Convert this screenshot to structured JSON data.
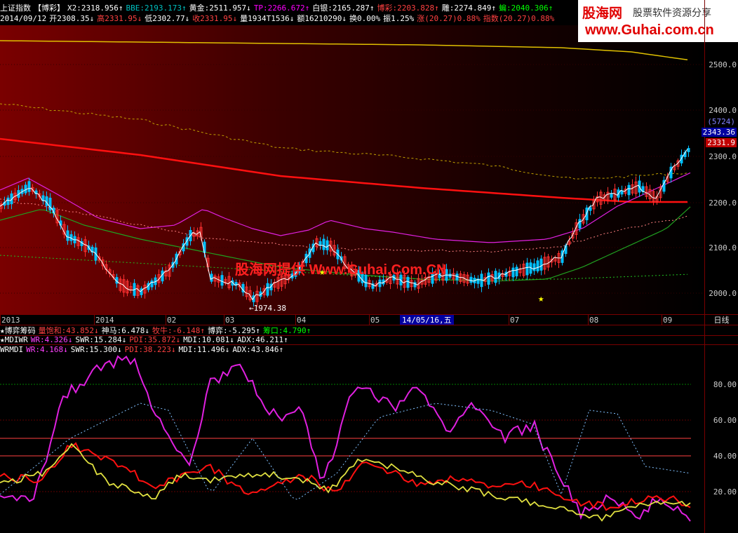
{
  "header": {
    "line1": [
      {
        "text": "上证指数",
        "color": "#ffffff"
      },
      {
        "text": "【博彩】",
        "color": "#ffffff"
      },
      {
        "text": "X2:2318.956↑",
        "color": "#ffffff"
      },
      {
        "text": "BBE:2193.173↑",
        "color": "#00c0c0"
      },
      {
        "text": "黄金:2511.957↓",
        "color": "#ffffff"
      },
      {
        "text": "TP:2266.672↑",
        "color": "#ff00ff"
      },
      {
        "text": "白银:2165.287↑",
        "color": "#ffffff"
      },
      {
        "text": "博彩:2203.828↑",
        "color": "#ff4040"
      },
      {
        "text": "雕:2274.849↑",
        "color": "#ffffff"
      },
      {
        "text": "蝙:2040.306↑",
        "color": "#00ff00"
      }
    ],
    "line2": [
      {
        "text": "2014/09/12",
        "color": "#ffffff"
      },
      {
        "text": "开2308.35↓",
        "color": "#ffffff"
      },
      {
        "text": "高2331.95↓",
        "color": "#ff4040"
      },
      {
        "text": "低2302.77↓",
        "color": "#ffffff"
      },
      {
        "text": "收2331.95↓",
        "color": "#ff4040"
      },
      {
        "text": "量1934T1536↓",
        "color": "#ffffff"
      },
      {
        "text": "额16210290↓",
        "color": "#ffffff"
      },
      {
        "text": "换0.00%",
        "color": "#ffffff"
      },
      {
        "text": "振1.25%",
        "color": "#ffffff"
      },
      {
        "text": "涨(20.27)0.88%",
        "color": "#ff4040"
      },
      {
        "text": "指数(20.27)0.88%",
        "color": "#ff4040"
      }
    ]
  },
  "logo": {
    "brand": "股海网",
    "tagline": "股票软件资源分享",
    "url": "www.Guhai.com.cn"
  },
  "watermark": "股海网提供 Www.Guhai.Com.CN",
  "price_axis": {
    "ticks": [
      "2500.0",
      "2400.0",
      "2300.0",
      "2200.0",
      "2100.0",
      "2000.0"
    ],
    "badge_count": "(5724)",
    "badge_high": "2343.36",
    "badge_close": "2331.9",
    "low_label": "←1974.38"
  },
  "time_axis": {
    "labels": [
      "2013",
      "2014",
      "02",
      "03",
      "04",
      "05",
      "07",
      "08",
      "09"
    ],
    "cursor_date": "14/05/16,五",
    "period": "日线"
  },
  "indicator_lines": {
    "line1": [
      {
        "text": "★博弈筹码",
        "color": "#ffffff"
      },
      {
        "text": "量饱和:43.852↓",
        "color": "#ff4040"
      },
      {
        "text": "神马:6.478↓",
        "color": "#ffffff"
      },
      {
        "text": "牧牛:-6.148↑",
        "color": "#ff4040"
      },
      {
        "text": "博弈:-5.295↑",
        "color": "#ffffff"
      },
      {
        "text": "筹口:4.790↑",
        "color": "#00ff00"
      }
    ],
    "line2": [
      {
        "text": "★MDIWR",
        "color": "#ffffff"
      },
      {
        "text": "WR:4.326↓",
        "color": "#ff40ff"
      },
      {
        "text": "SWR:15.284↓",
        "color": "#ffffff"
      },
      {
        "text": "PDI:35.872↓",
        "color": "#ff4040"
      },
      {
        "text": "MDI:10.081↓",
        "color": "#ffffff"
      },
      {
        "text": "ADX:46.211↑",
        "color": "#ffffff"
      }
    ],
    "line3": [
      {
        "text": "WRMDI",
        "color": "#ffffff"
      },
      {
        "text": "WR:4.168↓",
        "color": "#ff40ff"
      },
      {
        "text": "SWR:15.300↓",
        "color": "#ffffff"
      },
      {
        "text": "PDI:38.223↓",
        "color": "#ff4040"
      },
      {
        "text": "MDI:11.496↓",
        "color": "#ffffff"
      },
      {
        "text": "ADX:43.846↑",
        "color": "#ffffff"
      }
    ]
  },
  "sub_axis": {
    "ticks": [
      "80.00",
      "60.00",
      "40.00",
      "20.00"
    ]
  },
  "colors": {
    "red_bg": "#7a0000",
    "candle_up": "#ff3030",
    "candle_down": "#00c0ff",
    "ma_yellow": "#e0c000",
    "ma_magenta": "#e020e0",
    "ma_green": "#20a020"
  }
}
